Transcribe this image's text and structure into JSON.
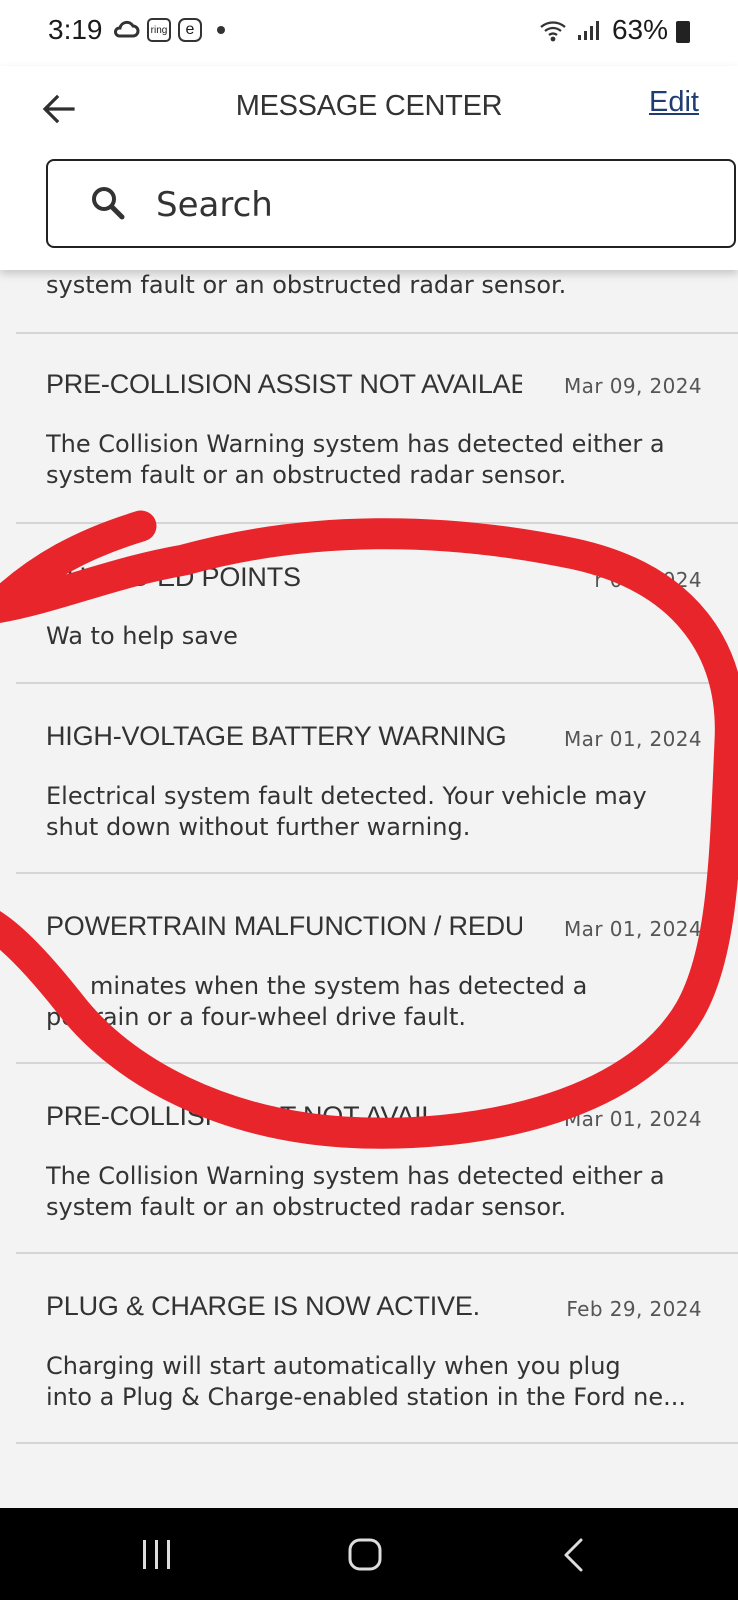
{
  "status_bar": {
    "time": "3:19",
    "notification_icons": [
      "cloud-icon",
      "ring-icon",
      "e-icon",
      "dot-icon"
    ],
    "ring_label": "ring",
    "e_label": "e",
    "battery_percent": "63%",
    "signal_icons": [
      "wifi-icon",
      "cell-signal-icon",
      "battery-icon"
    ]
  },
  "header": {
    "back_icon": "arrow-left-icon",
    "title": "MESSAGE CENTER",
    "edit_label": "Edit"
  },
  "search": {
    "icon": "search-icon",
    "placeholder": "Search"
  },
  "messages": [
    {
      "subject": "",
      "date": "",
      "body_lines": [
        "system fault or an obstructed radar sensor."
      ]
    },
    {
      "subject": "PRE-COLLISION ASSIST NOT AVAILABLE",
      "date": "Mar 09, 2024",
      "body_lines": [
        "The Collision Warning system has detected either a",
        "system fault or an obstructed radar sensor."
      ]
    },
    {
      "subject": "OU RED   ED POINTS",
      "date": "r 08, 2024",
      "body_lines": [
        "Wa  to help save"
      ]
    },
    {
      "subject": "HIGH-VOLTAGE BATTERY WARNING",
      "date": "Mar 01, 2024",
      "body_lines": [
        "Electrical system fault detected. Your vehicle may",
        "shut down without further warning."
      ]
    },
    {
      "subject": "POWERTRAIN MALFUNCTION / REDUC...",
      "date": "Mar 01, 2024",
      "body_lines": [
        "minates when the system has detected a",
        "po   train or a four-wheel drive fault."
      ]
    },
    {
      "subject": "PRE-COLLISI     SSIST NOT AVAIL",
      "date": "Mar 01, 2024",
      "body_lines": [
        "The Collision Warning system has detected either a",
        "system fault or an obstructed radar sensor."
      ]
    },
    {
      "subject": "PLUG & CHARGE IS NOW ACTIVE.",
      "date": "Feb 29, 2024",
      "body_lines": [
        "Charging will start automatically when you plug",
        "into a Plug & Charge-enabled station in the Ford ne..."
      ]
    }
  ],
  "annotation": {
    "color": "#e8252b",
    "shape": "hand-drawn circle"
  },
  "navbar": {
    "buttons": [
      "recents-icon",
      "home-icon",
      "back-icon"
    ]
  }
}
